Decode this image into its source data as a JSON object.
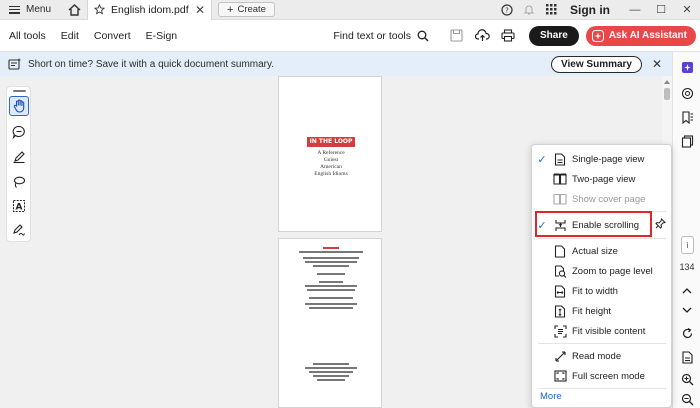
{
  "titlebar": {
    "menu_label": "Menu",
    "tab_title": "English idom.pdf",
    "create_label": "Create",
    "sign_in": "Sign in"
  },
  "toolbar": {
    "menus": [
      "All tools",
      "Edit",
      "Convert",
      "E-Sign"
    ],
    "find_label": "Find text or tools",
    "share_label": "Share",
    "ai_label": "Ask AI Assistant"
  },
  "notice": {
    "text": "Short on time? Save it with a quick document summary.",
    "button": "View Summary"
  },
  "document": {
    "cover_banner": "IN THE LOOP",
    "cover_lines": [
      "A Reference",
      "Guiest",
      "American",
      "English Idioms"
    ]
  },
  "rail": {
    "page_number": "134"
  },
  "view_menu": {
    "items": [
      {
        "label": "Single-page view",
        "checked": true,
        "disabled": false,
        "icon": "single-page-icon"
      },
      {
        "label": "Two-page view",
        "checked": false,
        "disabled": false,
        "icon": "two-page-icon"
      },
      {
        "label": "Show cover page",
        "checked": false,
        "disabled": true,
        "icon": "cover-page-icon"
      },
      {
        "label": "Enable scrolling",
        "checked": true,
        "disabled": false,
        "icon": "scrolling-icon"
      },
      {
        "label": "Actual size",
        "checked": false,
        "disabled": false,
        "icon": "actual-size-icon"
      },
      {
        "label": "Zoom to page level",
        "checked": false,
        "disabled": false,
        "icon": "zoom-page-icon"
      },
      {
        "label": "Fit to width",
        "checked": false,
        "disabled": false,
        "icon": "fit-width-icon"
      },
      {
        "label": "Fit height",
        "checked": false,
        "disabled": false,
        "icon": "fit-height-icon"
      },
      {
        "label": "Fit visible content",
        "checked": false,
        "disabled": false,
        "icon": "fit-visible-icon"
      },
      {
        "label": "Read mode",
        "checked": false,
        "disabled": false,
        "icon": "read-mode-icon"
      },
      {
        "label": "Full screen mode",
        "checked": false,
        "disabled": false,
        "icon": "full-screen-icon"
      }
    ],
    "more_label": "More"
  },
  "colors": {
    "accent": "#1c6adf",
    "ai_button": "#e8484a",
    "highlight": "#e0262b",
    "notice_bg": "#e4eef9"
  }
}
